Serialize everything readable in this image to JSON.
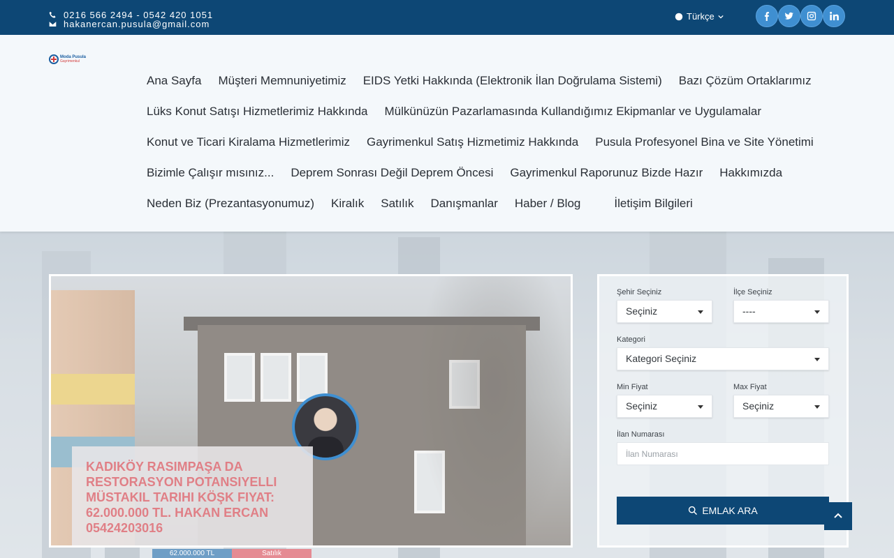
{
  "topbar": {
    "phones": "0216 566 2494 - 0542 420 1051",
    "email": "hakanercan.pusula@gmail.com",
    "language": "Türkçe",
    "social": [
      "facebook",
      "twitter",
      "instagram",
      "linkedin"
    ]
  },
  "logo": {
    "line1": "Moda Pusula",
    "line2": "Gayrimenkul"
  },
  "menu": {
    "rows": [
      [
        "Ana Sayfa",
        "Müşteri Memnuniyetimiz",
        "EIDS Yetki Hakkında (Elektronik İlan Doğrulama Sistemi)",
        "Bazı Çözüm Ortaklarımız"
      ],
      [
        "Lüks Konut Satışı Hizmetlerimiz Hakkında",
        "Mülkünüzün Pazarlamasında Kullandığımız Ekipmanlar ve Uygulamalar"
      ],
      [
        "Konut ve Ticari Kiralama Hizmetlerimiz",
        "Gayrimenkul Satış Hizmetimiz Hakkında",
        "Pusula Profesyonel Bina ve Site Yönetimi"
      ],
      [
        "Bizimle Çalışır mısınız...",
        "Deprem Sonrası Değil Deprem Öncesi",
        "Gayrimenkul Raporunuz Bizde Hazır",
        "Hakkımızda"
      ],
      [
        "Neden Biz (Prezantasyonumuz)",
        "Kiralık",
        "Satılık",
        "Danışmanlar",
        "Haber / Blog",
        "İletişim Bilgileri"
      ]
    ]
  },
  "listing": {
    "title": "KADIKÖY RASIMPAŞA DA RESTORASYON POTANSIYELLI MÜSTAKIL TARIHI KÖŞK FIYAT: 62.000.000 TL. HAKAN ERCAN 05424203016",
    "price_tag": "62.000.000 TL",
    "type_tag": "Satılık"
  },
  "search": {
    "city_label": "Şehir Seçiniz",
    "city_value": "Seçiniz",
    "district_label": "İlçe Seçiniz",
    "district_value": "----",
    "category_label": "Kategori",
    "category_value": "Kategori Seçiniz",
    "min_label": "Min Fiyat",
    "min_value": "Seçiniz",
    "max_label": "Max Fiyat",
    "max_value": "Seçiniz",
    "listing_no_label": "İlan Numarası",
    "listing_no_placeholder": "İlan Numarası",
    "button_label": "EMLAK ARA"
  }
}
